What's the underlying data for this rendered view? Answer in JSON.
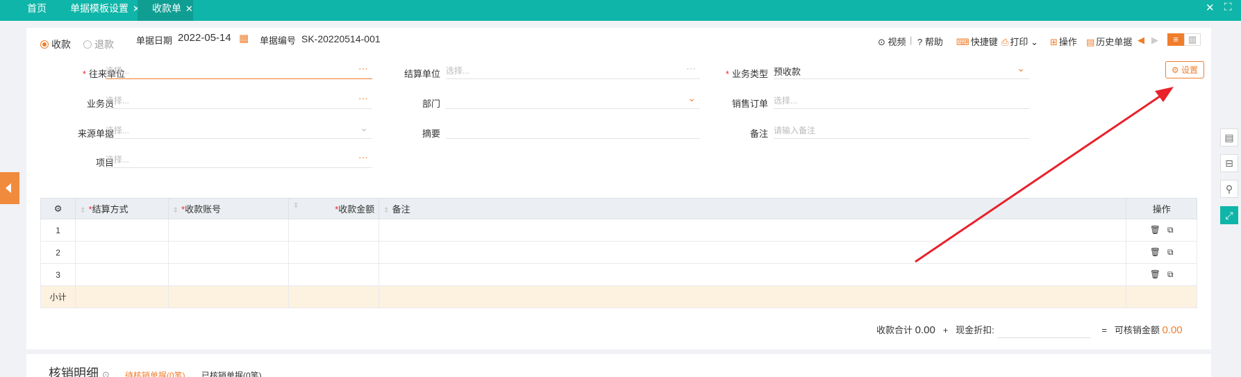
{
  "tabs": {
    "home": "首页",
    "template": "单据模板设置",
    "current": "收款单"
  },
  "radio": {
    "receive": "收款",
    "refund": "退款"
  },
  "header": {
    "date_label": "单据日期",
    "date_value": "2022-05-14",
    "no_label": "单据编号",
    "no_value": "SK-20220514-001"
  },
  "toolbar": {
    "video": "视频",
    "help": "帮助",
    "shortcut": "快捷键",
    "print": "打印",
    "operate": "操作",
    "history": "历史单据"
  },
  "settings_button": "设置",
  "form": {
    "partner": {
      "label": "往来单位",
      "placeholder": "选择..."
    },
    "settle_unit": {
      "label": "结算单位",
      "placeholder": "选择..."
    },
    "biz_type": {
      "label": "业务类型",
      "value": "预收款"
    },
    "salesman": {
      "label": "业务员",
      "placeholder": "选择..."
    },
    "dept": {
      "label": "部门",
      "placeholder": ""
    },
    "sales_order": {
      "label": "销售订单",
      "placeholder": "选择..."
    },
    "source": {
      "label": "来源单据",
      "placeholder": "选择..."
    },
    "summary": {
      "label": "摘要",
      "placeholder": ""
    },
    "remark": {
      "label": "备注",
      "placeholder": "请输入备注"
    },
    "project": {
      "label": "项目",
      "placeholder": "选择..."
    }
  },
  "grid": {
    "columns": [
      "结算方式",
      "收款账号",
      "收款金额",
      "备注",
      "操作"
    ],
    "rows": [
      "1",
      "2",
      "3"
    ],
    "subtotal": "小计"
  },
  "summary": {
    "total_label": "收款合计",
    "total_value": "0.00",
    "plus": "+",
    "discount_label": "现金折扣:",
    "eq": "=",
    "writeoff_label": "可核销金额",
    "writeoff_value": "0.00"
  },
  "bottom": {
    "title": "核销明细",
    "pending": "待核销单据(0笔)",
    "done": "已核销单据(0笔)"
  },
  "colors": {
    "teal": "#0fb5a8",
    "orange": "#f07d2c",
    "arrow": "#e8212b"
  }
}
